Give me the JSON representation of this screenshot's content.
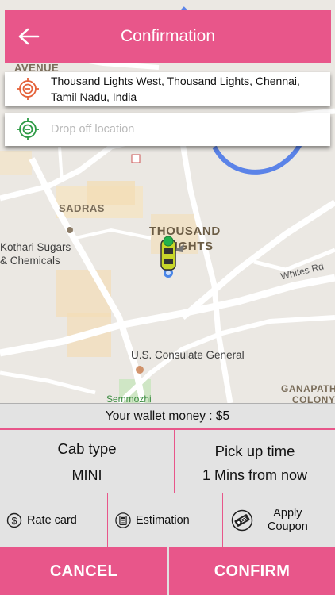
{
  "header": {
    "title": "Confirmation",
    "back_icon": "arrow-left-icon"
  },
  "pickup": {
    "address_line1": "Thousand Lights West, Thousand Lights, Chennai,",
    "address_line2": "Tamil Nadu, India",
    "icon": "pickup-target-icon",
    "icon_color": "#e5623a"
  },
  "dropoff": {
    "placeholder": "Drop off location",
    "icon": "dropoff-target-icon",
    "icon_color": "#2e9b46"
  },
  "map": {
    "labels": {
      "avenue": "AVENUE",
      "sadras": "SADRAS",
      "kothari_line1": "Kothari Sugars",
      "kothari_line2": "& Chemicals",
      "thousand_line1": "THOUSAND",
      "thousand_line2": "LIGHTS",
      "whites_rd": "Whites Rd",
      "consulate": "U.S. Consulate General",
      "ganapathy_line1": "GANAPATH",
      "ganapathy_line2": "COLONY",
      "semmozhi": "Semmozhi"
    },
    "car_icon": "cab-car-icon"
  },
  "wallet": {
    "text": "Your wallet money : $5"
  },
  "cab_type": {
    "title": "Cab type",
    "value": "MINI"
  },
  "pickup_time": {
    "title": "Pick up time",
    "value": "1 Mins from now"
  },
  "options": {
    "rate_card": {
      "label": "Rate card",
      "icon": "dollar-icon"
    },
    "estimation": {
      "label": "Estimation",
      "icon": "calculator-icon"
    },
    "coupon": {
      "label_line1": "Apply",
      "label_line2": "Coupon",
      "icon": "coupon-icon"
    }
  },
  "buttons": {
    "cancel": "CANCEL",
    "confirm": "CONFIRM"
  },
  "colors": {
    "accent": "#e8568a",
    "pickup": "#e5623a",
    "dropoff": "#2e9b46"
  }
}
